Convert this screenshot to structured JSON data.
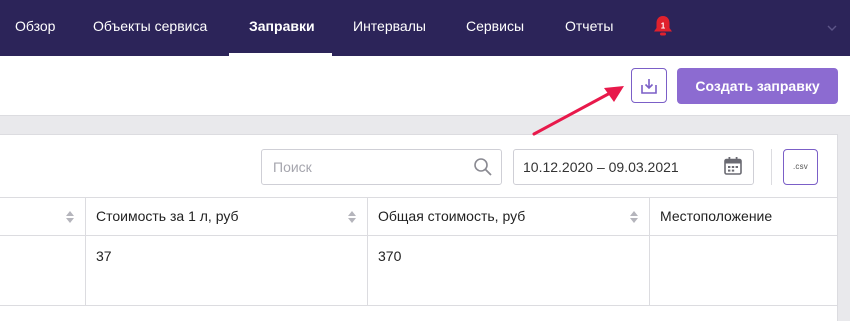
{
  "nav": {
    "items": [
      {
        "label": "Обзор"
      },
      {
        "label": "Объекты сервиса"
      },
      {
        "label": "Заправки"
      },
      {
        "label": "Интервалы"
      },
      {
        "label": "Сервисы"
      },
      {
        "label": "Отчеты"
      }
    ],
    "active": "Заправки",
    "notification_count": "1"
  },
  "actions": {
    "create_label": "Создать заправку"
  },
  "filters": {
    "search_placeholder": "Поиск",
    "date_range": "10.12.2020 – 09.03.2021",
    "csv_label": ".csv"
  },
  "table": {
    "columns": [
      {
        "label": ""
      },
      {
        "label": "Стоимость за 1 л, руб"
      },
      {
        "label": "Общая стоимость, руб"
      },
      {
        "label": "Местоположение"
      }
    ],
    "rows": [
      [
        "",
        "37",
        "370",
        ""
      ]
    ]
  },
  "colors": {
    "nav_bg": "#2c2459",
    "accent": "#8c6bd1",
    "annotation_arrow": "#e8194b"
  }
}
